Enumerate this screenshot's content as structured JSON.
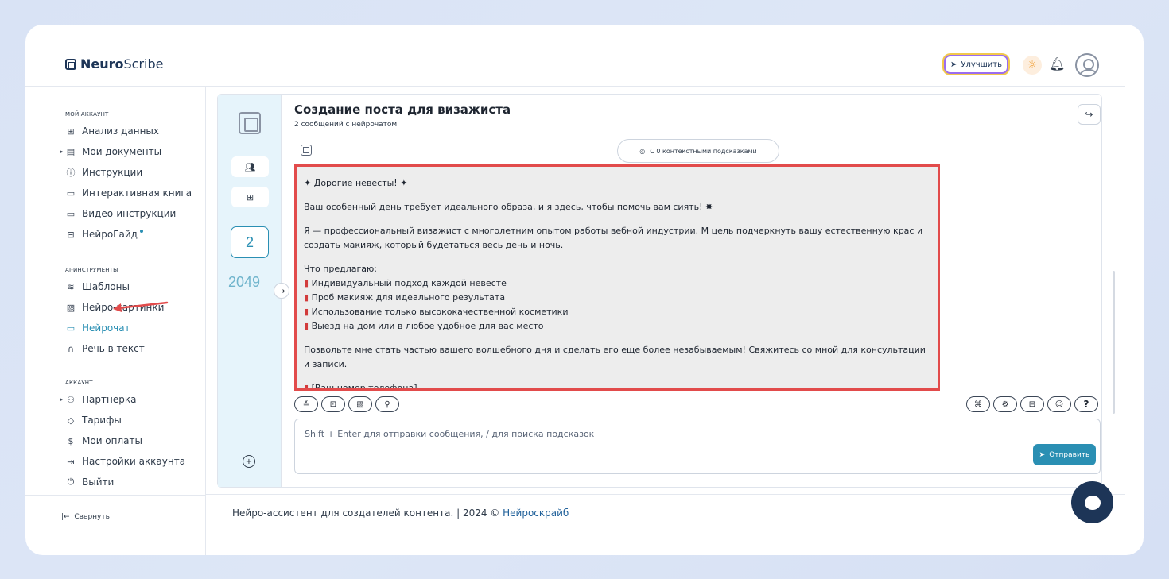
{
  "brand": {
    "name_bold": "Neuro",
    "name_light": "Scribe"
  },
  "topbar": {
    "upgrade_label": "Улучшить",
    "upgrade_icon": "rocket-icon",
    "theme_icon": "sun-icon",
    "bell_icon": "bell-icon"
  },
  "sidebar": {
    "section_account": "МОЙ АККАУНТ",
    "account_items": [
      {
        "label": "Анализ данных",
        "icon": "grid-icon"
      },
      {
        "label": "Мои документы",
        "icon": "document-icon",
        "caret": true
      },
      {
        "label": "Инструкции",
        "icon": "help-circle-icon"
      },
      {
        "label": "Интерактивная книга",
        "icon": "book-icon"
      },
      {
        "label": "Видео-инструкции",
        "icon": "video-icon"
      },
      {
        "label": "НейроГайд",
        "icon": "guide-icon",
        "badge": true
      }
    ],
    "section_ai": "AI-ИНСТРУМЕНТЫ",
    "ai_items": [
      {
        "label": "Шаблоны",
        "icon": "layers-icon"
      },
      {
        "label": "Нейро-картинки",
        "icon": "image-icon"
      },
      {
        "label": "Нейрочат",
        "icon": "chat-icon",
        "active": true
      },
      {
        "label": "Речь в текст",
        "icon": "headphones-icon"
      }
    ],
    "section_acc2": "АККАУНТ",
    "acc_items": [
      {
        "label": "Партнерка",
        "icon": "users-icon",
        "caret": true
      },
      {
        "label": "Тарифы",
        "icon": "tag-icon"
      },
      {
        "label": "Мои оплаты",
        "icon": "dollar-icon"
      },
      {
        "label": "Настройки аккаунта",
        "icon": "login-icon"
      },
      {
        "label": "Выйти",
        "icon": "power-icon"
      }
    ],
    "collapse_label": "Свернуть"
  },
  "chat": {
    "title": "Создание поста для визажиста",
    "subtitle": "2 сообщений с нейрочатом",
    "message_count": "2",
    "tokens": "2049",
    "context_label": "С 0 контекстными подсказками",
    "message": {
      "greeting": "Дорогие невесты!",
      "p1": "Ваш особенный день требует идеального образа, и я здесь, чтобы помочь вам сиять!",
      "p2": "Я — профессиональный визажист с многолетним опытом работы вебной индустрии. М цель подчеркнуть вашу естественную крас и создать макияж, который будетаться весь день и ночь.",
      "offer_title": "Что предлагаю:",
      "offers": [
        "Индивидуальный подход каждой невесте",
        "Проб макияж для идеального результата",
        "Использование только высококачественной косметики",
        "Выезд на дом или в любое удобное для вас место"
      ],
      "p3": "Позвольте мне стать частью вашего волшебного дня и сделать его еще более незабываемым! Свяжитесь со мной для консультации и записи.",
      "p4": "[Ваш номер телефона]"
    },
    "input_placeholder": "Shift + Enter для отправки сообщения, / для поиска подсказок",
    "send_label": "Отправить"
  },
  "footer": {
    "text": "Нейро-ассистент для создателей контента.  | 2024 ©",
    "link": "Нейроскрайб"
  },
  "colors": {
    "accent": "#2a8fb3",
    "highlight": "#e24b4b",
    "navy": "#1d3557"
  }
}
